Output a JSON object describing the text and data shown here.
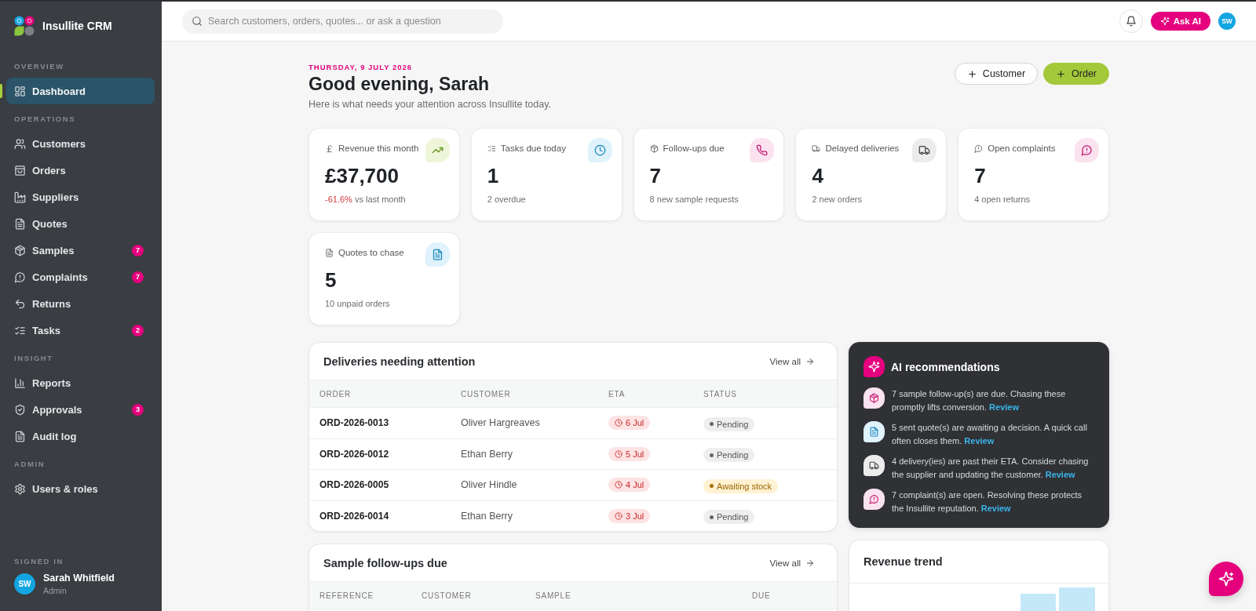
{
  "sidebar": {
    "brand": "Insullite CRM",
    "sections": [
      {
        "title": "OVERVIEW",
        "items": [
          {
            "label": "Dashboard",
            "selected": true
          }
        ]
      },
      {
        "title": "OPERATIONS",
        "items": [
          {
            "label": "Customers",
            "selected": false
          },
          {
            "label": "Orders",
            "selected": false
          },
          {
            "label": "Suppliers",
            "selected": false
          },
          {
            "label": "Quotes",
            "selected": false
          },
          {
            "label": "Samples",
            "selected": false,
            "badge": "7"
          },
          {
            "label": "Complaints",
            "selected": false,
            "badge": "7"
          },
          {
            "label": "Returns",
            "selected": false
          },
          {
            "label": "Tasks",
            "selected": false,
            "badge": "2"
          }
        ]
      },
      {
        "title": "INSIGHT",
        "items": [
          {
            "label": "Reports",
            "selected": false
          },
          {
            "label": "Approvals",
            "selected": false,
            "badge": "3"
          },
          {
            "label": "Audit log",
            "selected": false
          }
        ]
      },
      {
        "title": "ADMIN",
        "items": [
          {
            "label": "Users & roles",
            "selected": false
          }
        ]
      }
    ],
    "signed_in": {
      "title": "SIGNED IN",
      "initials": "SW",
      "name": "Sarah Whitfield",
      "role": "Admin"
    }
  },
  "header": {
    "search": {
      "placeholder": "Search customers, orders, quotes... or ask a question"
    },
    "ask_ai": "Ask AI",
    "avatar": "SW"
  },
  "greeting": {
    "date": "THURSDAY, 9 JULY 2026",
    "title": "Good evening, Sarah",
    "subtitle": "Here is what needs your attention across Insullite today.",
    "buttons": [
      {
        "label": "Customer",
        "kind": "outline"
      },
      {
        "label": "Order",
        "kind": "primary"
      }
    ]
  },
  "stats": [
    {
      "label": "Revenue this month",
      "value": "£37,700",
      "change": {
        "text": "-61.6%",
        "negative": true
      },
      "note": "vs last month"
    },
    {
      "label": "Tasks due today",
      "value": "1",
      "note": "2 overdue"
    },
    {
      "label": "Follow-ups due",
      "value": "7",
      "note": "8 new sample requests"
    },
    {
      "label": "Delayed deliveries",
      "value": "4",
      "note": "2 new orders"
    },
    {
      "label": "Open complaints",
      "value": "7",
      "note": "4 open returns"
    },
    {
      "label": "Quotes to chase",
      "value": "5",
      "note": "10 unpaid orders"
    }
  ],
  "deliveries": {
    "title": "Deliveries needing attention",
    "link": "View all",
    "columns": [
      "ORDER",
      "CUSTOMER",
      "ETA",
      "STATUS"
    ],
    "rows": [
      {
        "order": "ORD-2026-0013",
        "customer": "Oliver Hargreaves",
        "eta": {
          "text": "6 Jul",
          "overdue": true
        },
        "status": {
          "text": "Pending",
          "kind": "pending"
        }
      },
      {
        "order": "ORD-2026-0012",
        "customer": "Ethan Berry",
        "eta": {
          "text": "5 Jul",
          "overdue": true
        },
        "status": {
          "text": "Pending",
          "kind": "pending"
        }
      },
      {
        "order": "ORD-2026-0005",
        "customer": "Oliver Hindle",
        "eta": {
          "text": "4 Jul",
          "overdue": true
        },
        "status": {
          "text": "Awaiting stock",
          "kind": "awaiting"
        }
      },
      {
        "order": "ORD-2026-0014",
        "customer": "Ethan Berry",
        "eta": {
          "text": "3 Jul",
          "overdue": true
        },
        "status": {
          "text": "Pending",
          "kind": "pending"
        }
      }
    ]
  },
  "sample_followups": {
    "title": "Sample follow-ups due",
    "link": "View all",
    "columns": [
      "REFERENCE",
      "CUSTOMER",
      "SAMPLE",
      "DUE"
    ]
  },
  "ai_recommendations": {
    "title": "AI recommendations",
    "items": [
      {
        "text": "7 sample follow-up(s) are due. Chasing these promptly lifts conversion.",
        "link": "Review"
      },
      {
        "text": "5 sent quote(s) are awaiting a decision. A quick call often closes them.",
        "link": "Review"
      },
      {
        "text": "4 delivery(ies) are past their ETA. Consider chasing the supplier and updating the customer.",
        "link": "Review"
      },
      {
        "text": "7 complaint(s) are open. Resolving these protects the Insullite reputation.",
        "link": "Review"
      }
    ]
  },
  "revenue_trend": {
    "title": "Revenue trend"
  }
}
